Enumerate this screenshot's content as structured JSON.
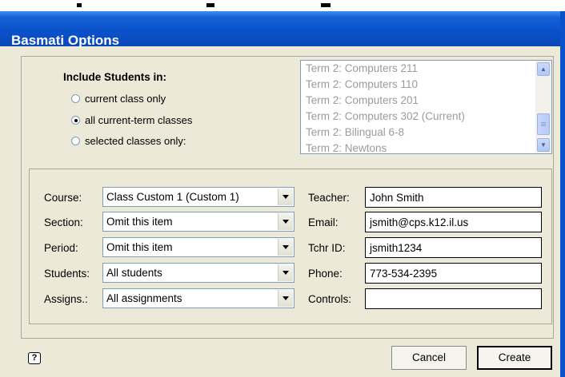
{
  "window": {
    "title": "Basmati Options"
  },
  "include": {
    "heading": "Include Students in:",
    "options": [
      {
        "label": "current class only",
        "checked": false
      },
      {
        "label": "all current-term classes",
        "checked": true
      },
      {
        "label": "selected classes only:",
        "checked": false
      }
    ]
  },
  "class_list": {
    "items": [
      "Term 2: Computers 211",
      "Term 2: Computers 110",
      "Term 2: Computers 201",
      "Term 2: Computers 302 (Current)",
      "Term 2: Bilingual 6-8",
      "Term 2: Newtons"
    ]
  },
  "fields": {
    "course": {
      "label": "Course:",
      "value": "Class Custom 1 (Custom 1)"
    },
    "section": {
      "label": "Section:",
      "value": "Omit this item"
    },
    "period": {
      "label": "Period:",
      "value": "Omit this item"
    },
    "students": {
      "label": "Students:",
      "value": "All students"
    },
    "assigns": {
      "label": "Assigns.:",
      "value": "All assignments"
    },
    "teacher": {
      "label": "Teacher:",
      "value": "John Smith"
    },
    "email": {
      "label": "Email:",
      "value": "jsmith@cps.k12.il.us"
    },
    "tchr_id": {
      "label": "Tchr ID:",
      "value": "jsmith1234"
    },
    "phone": {
      "label": "Phone:",
      "value": "773-534-2395"
    },
    "controls": {
      "label": "Controls:",
      "value": ""
    }
  },
  "help": {
    "glyph": "?"
  },
  "buttons": {
    "cancel": "Cancel",
    "create": "Create"
  },
  "icons": {
    "help": "help-icon",
    "scroll_up": "chevron-up-icon",
    "scroll_down": "chevron-down-icon",
    "dropdown": "chevron-down-icon"
  },
  "colors": {
    "titlebar": "#0a52cb",
    "dialog_bg": "#ece9d8",
    "disabled_text": "#9b9b9b"
  }
}
